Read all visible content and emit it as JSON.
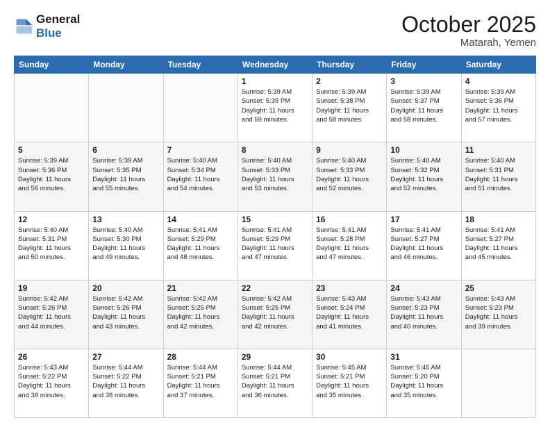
{
  "header": {
    "logo_line1": "General",
    "logo_line2": "Blue",
    "month": "October 2025",
    "location": "Matarah, Yemen"
  },
  "weekdays": [
    "Sunday",
    "Monday",
    "Tuesday",
    "Wednesday",
    "Thursday",
    "Friday",
    "Saturday"
  ],
  "weeks": [
    [
      {
        "day": "",
        "info": ""
      },
      {
        "day": "",
        "info": ""
      },
      {
        "day": "",
        "info": ""
      },
      {
        "day": "1",
        "info": "Sunrise: 5:39 AM\nSunset: 5:39 PM\nDaylight: 11 hours\nand 59 minutes."
      },
      {
        "day": "2",
        "info": "Sunrise: 5:39 AM\nSunset: 5:38 PM\nDaylight: 11 hours\nand 58 minutes."
      },
      {
        "day": "3",
        "info": "Sunrise: 5:39 AM\nSunset: 5:37 PM\nDaylight: 11 hours\nand 58 minutes."
      },
      {
        "day": "4",
        "info": "Sunrise: 5:39 AM\nSunset: 5:36 PM\nDaylight: 11 hours\nand 57 minutes."
      }
    ],
    [
      {
        "day": "5",
        "info": "Sunrise: 5:39 AM\nSunset: 5:36 PM\nDaylight: 11 hours\nand 56 minutes."
      },
      {
        "day": "6",
        "info": "Sunrise: 5:39 AM\nSunset: 5:35 PM\nDaylight: 11 hours\nand 55 minutes."
      },
      {
        "day": "7",
        "info": "Sunrise: 5:40 AM\nSunset: 5:34 PM\nDaylight: 11 hours\nand 54 minutes."
      },
      {
        "day": "8",
        "info": "Sunrise: 5:40 AM\nSunset: 5:33 PM\nDaylight: 11 hours\nand 53 minutes."
      },
      {
        "day": "9",
        "info": "Sunrise: 5:40 AM\nSunset: 5:33 PM\nDaylight: 11 hours\nand 52 minutes."
      },
      {
        "day": "10",
        "info": "Sunrise: 5:40 AM\nSunset: 5:32 PM\nDaylight: 11 hours\nand 52 minutes."
      },
      {
        "day": "11",
        "info": "Sunrise: 5:40 AM\nSunset: 5:31 PM\nDaylight: 11 hours\nand 51 minutes."
      }
    ],
    [
      {
        "day": "12",
        "info": "Sunrise: 5:40 AM\nSunset: 5:31 PM\nDaylight: 11 hours\nand 50 minutes."
      },
      {
        "day": "13",
        "info": "Sunrise: 5:40 AM\nSunset: 5:30 PM\nDaylight: 11 hours\nand 49 minutes."
      },
      {
        "day": "14",
        "info": "Sunrise: 5:41 AM\nSunset: 5:29 PM\nDaylight: 11 hours\nand 48 minutes."
      },
      {
        "day": "15",
        "info": "Sunrise: 5:41 AM\nSunset: 5:29 PM\nDaylight: 11 hours\nand 47 minutes."
      },
      {
        "day": "16",
        "info": "Sunrise: 5:41 AM\nSunset: 5:28 PM\nDaylight: 11 hours\nand 47 minutes."
      },
      {
        "day": "17",
        "info": "Sunrise: 5:41 AM\nSunset: 5:27 PM\nDaylight: 11 hours\nand 46 minutes."
      },
      {
        "day": "18",
        "info": "Sunrise: 5:41 AM\nSunset: 5:27 PM\nDaylight: 11 hours\nand 45 minutes."
      }
    ],
    [
      {
        "day": "19",
        "info": "Sunrise: 5:42 AM\nSunset: 5:26 PM\nDaylight: 11 hours\nand 44 minutes."
      },
      {
        "day": "20",
        "info": "Sunrise: 5:42 AM\nSunset: 5:26 PM\nDaylight: 11 hours\nand 43 minutes."
      },
      {
        "day": "21",
        "info": "Sunrise: 5:42 AM\nSunset: 5:25 PM\nDaylight: 11 hours\nand 42 minutes."
      },
      {
        "day": "22",
        "info": "Sunrise: 5:42 AM\nSunset: 5:25 PM\nDaylight: 11 hours\nand 42 minutes."
      },
      {
        "day": "23",
        "info": "Sunrise: 5:43 AM\nSunset: 5:24 PM\nDaylight: 11 hours\nand 41 minutes."
      },
      {
        "day": "24",
        "info": "Sunrise: 5:43 AM\nSunset: 5:23 PM\nDaylight: 11 hours\nand 40 minutes."
      },
      {
        "day": "25",
        "info": "Sunrise: 5:43 AM\nSunset: 5:23 PM\nDaylight: 11 hours\nand 39 minutes."
      }
    ],
    [
      {
        "day": "26",
        "info": "Sunrise: 5:43 AM\nSunset: 5:22 PM\nDaylight: 11 hours\nand 38 minutes."
      },
      {
        "day": "27",
        "info": "Sunrise: 5:44 AM\nSunset: 5:22 PM\nDaylight: 11 hours\nand 38 minutes."
      },
      {
        "day": "28",
        "info": "Sunrise: 5:44 AM\nSunset: 5:21 PM\nDaylight: 11 hours\nand 37 minutes."
      },
      {
        "day": "29",
        "info": "Sunrise: 5:44 AM\nSunset: 5:21 PM\nDaylight: 11 hours\nand 36 minutes."
      },
      {
        "day": "30",
        "info": "Sunrise: 5:45 AM\nSunset: 5:21 PM\nDaylight: 11 hours\nand 35 minutes."
      },
      {
        "day": "31",
        "info": "Sunrise: 5:45 AM\nSunset: 5:20 PM\nDaylight: 11 hours\nand 35 minutes."
      },
      {
        "day": "",
        "info": ""
      }
    ]
  ]
}
